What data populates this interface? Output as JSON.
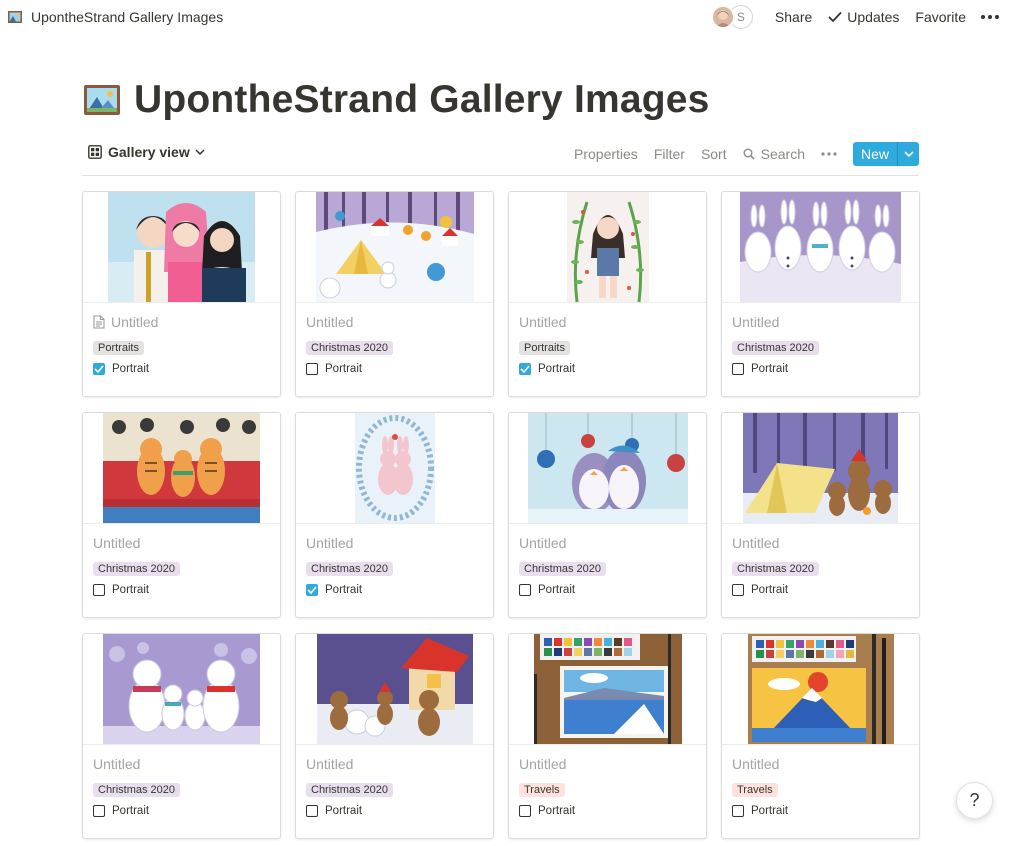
{
  "topbar": {
    "page_title": "UpontheStrand Gallery Images",
    "avatar_letter": "S",
    "share": "Share",
    "updates": "Updates",
    "favorite": "Favorite"
  },
  "header": {
    "title": "UpontheStrand Gallery Images"
  },
  "viewbar": {
    "view_name": "Gallery view",
    "properties": "Properties",
    "filter": "Filter",
    "sort": "Sort",
    "search": "Search",
    "new": "New"
  },
  "property_name": "Portrait",
  "cards": [
    {
      "title": "Untitled",
      "tag": "Portraits",
      "portrait": true,
      "art": "kids-portrait"
    },
    {
      "title": "Untitled",
      "tag": "Christmas 2020",
      "portrait": false,
      "art": "snow-village-tent"
    },
    {
      "title": "Untitled",
      "tag": "Portraits",
      "portrait": true,
      "art": "girl-vines"
    },
    {
      "title": "Untitled",
      "tag": "Christmas 2020",
      "portrait": false,
      "art": "snow-bunnies"
    },
    {
      "title": "Untitled",
      "tag": "Christmas 2020",
      "portrait": false,
      "art": "tigers-bench"
    },
    {
      "title": "Untitled",
      "tag": "Christmas 2020",
      "portrait": true,
      "art": "bunnies-wreath"
    },
    {
      "title": "Untitled",
      "tag": "Christmas 2020",
      "portrait": false,
      "art": "penguins-ornaments"
    },
    {
      "title": "Untitled",
      "tag": "Christmas 2020",
      "portrait": false,
      "art": "bears-tent"
    },
    {
      "title": "Untitled",
      "tag": "Christmas 2020",
      "portrait": false,
      "art": "polar-bears"
    },
    {
      "title": "Untitled",
      "tag": "Christmas 2020",
      "portrait": false,
      "art": "bears-house"
    },
    {
      "title": "Untitled",
      "tag": "Travels",
      "portrait": false,
      "art": "palette-lake"
    },
    {
      "title": "Untitled",
      "tag": "Travels",
      "portrait": false,
      "art": "palette-mountain"
    }
  ],
  "help": "?",
  "colors": {
    "accent": "#2eaadc",
    "tag_portraits": "#e3e2e0",
    "tag_christmas": "#e8deee",
    "tag_travels": "#ffe2dd"
  }
}
